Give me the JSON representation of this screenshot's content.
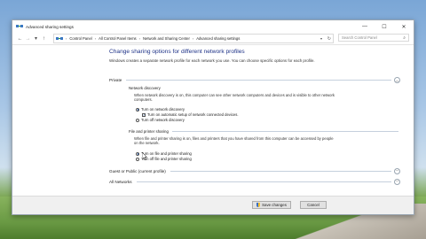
{
  "window": {
    "title": "Advanced sharing settings",
    "controls": [
      "—",
      "☐",
      "✕"
    ]
  },
  "address": {
    "crumbs": [
      "Control Panel",
      "All Control Panel Items",
      "Network and Sharing Center",
      "Advanced sharing settings"
    ],
    "search_placeholder": "Search Control Panel"
  },
  "main": {
    "heading": "Change sharing options for different network profiles",
    "intro": "Windows creates a separate network profile for each network you use. You can choose specific options for each profile.",
    "private": {
      "label": "Private",
      "network_discovery": {
        "label": "Network discovery",
        "desc": "When network discovery is on, this computer can see other network computers and devices and is visible to other network computers.",
        "options": [
          "Turn on network discovery",
          "Turn off network discovery"
        ],
        "auto_setup": "Turn on automatic setup of network connected devices."
      },
      "file_printer": {
        "label": "File and printer sharing",
        "desc": "When file and printer sharing is on, files and printers that you have shared from this computer can be accessed by people on the network.",
        "options": [
          "Turn on file and printer sharing",
          "Turn off file and printer sharing"
        ]
      }
    },
    "guest": {
      "label": "Guest or Public (current profile)"
    },
    "all": {
      "label": "All Networks"
    }
  },
  "footer": {
    "save_label": "Save changes",
    "cancel_label": "Cancel"
  }
}
